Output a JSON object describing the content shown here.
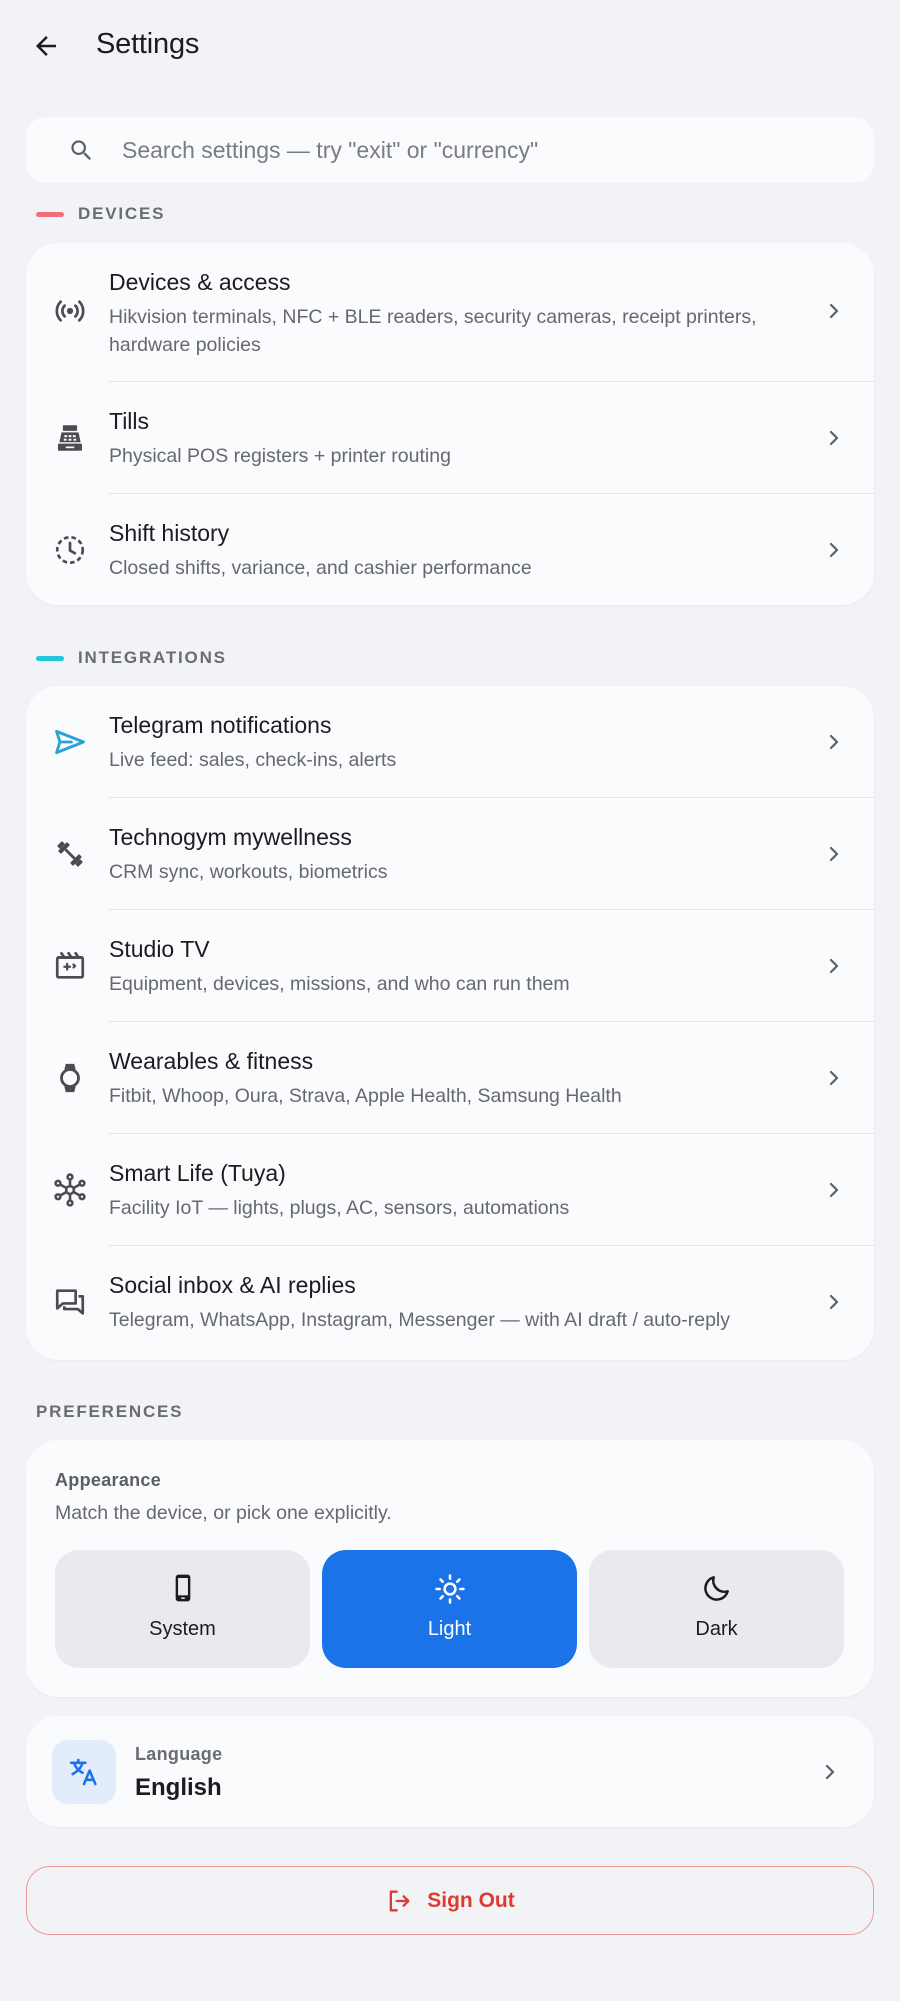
{
  "header": {
    "title": "Settings"
  },
  "search": {
    "placeholder": "Search settings — try \"exit\" or \"currency\""
  },
  "devices": {
    "label": "DEVICES",
    "accent": "#f0707a",
    "items": [
      {
        "icon": "nfc-signal-icon",
        "title": "Devices & access",
        "subtitle": "Hikvision terminals, NFC + BLE readers, security cameras, receipt printers, hardware policies"
      },
      {
        "icon": "cash-register-icon",
        "title": "Tills",
        "subtitle": "Physical POS registers + printer routing"
      },
      {
        "icon": "history-clock-icon",
        "title": "Shift history",
        "subtitle": "Closed shifts, variance, and cashier performance"
      }
    ]
  },
  "integrations": {
    "label": "INTEGRATIONS",
    "accent": "#26c6da",
    "items": [
      {
        "icon": "send-icon",
        "title": "Telegram notifications",
        "subtitle": "Live feed: sales, check-ins, alerts"
      },
      {
        "icon": "dumbbell-icon",
        "title": "Technogym mywellness",
        "subtitle": "CRM sync, workouts, biometrics"
      },
      {
        "icon": "movie-clapper-icon",
        "title": "Studio TV",
        "subtitle": "Equipment, devices, missions, and who can run them"
      },
      {
        "icon": "smartwatch-icon",
        "title": "Wearables & fitness",
        "subtitle": "Fitbit, Whoop, Oura, Strava, Apple Health, Samsung Health"
      },
      {
        "icon": "hub-icon",
        "title": "Smart Life (Tuya)",
        "subtitle": "Facility IoT — lights, plugs, AC, sensors, automations"
      },
      {
        "icon": "forum-icon",
        "title": "Social inbox & AI replies",
        "subtitle": "Telegram, WhatsApp, Instagram, Messenger — with AI draft / auto-reply"
      }
    ]
  },
  "preferences": {
    "label": "PREFERENCES",
    "appearance": {
      "label": "Appearance",
      "description": "Match the device, or pick one explicitly.",
      "options": [
        {
          "icon": "phone-icon",
          "label": "System",
          "selected": false
        },
        {
          "icon": "sun-icon",
          "label": "Light",
          "selected": true
        },
        {
          "icon": "moon-icon",
          "label": "Dark",
          "selected": false
        }
      ],
      "active_color": "#1a73e8"
    },
    "language": {
      "icon": "translate-icon",
      "label": "Language",
      "value": "English"
    }
  },
  "signout": {
    "label": "Sign Out",
    "color": "#de3b30"
  }
}
